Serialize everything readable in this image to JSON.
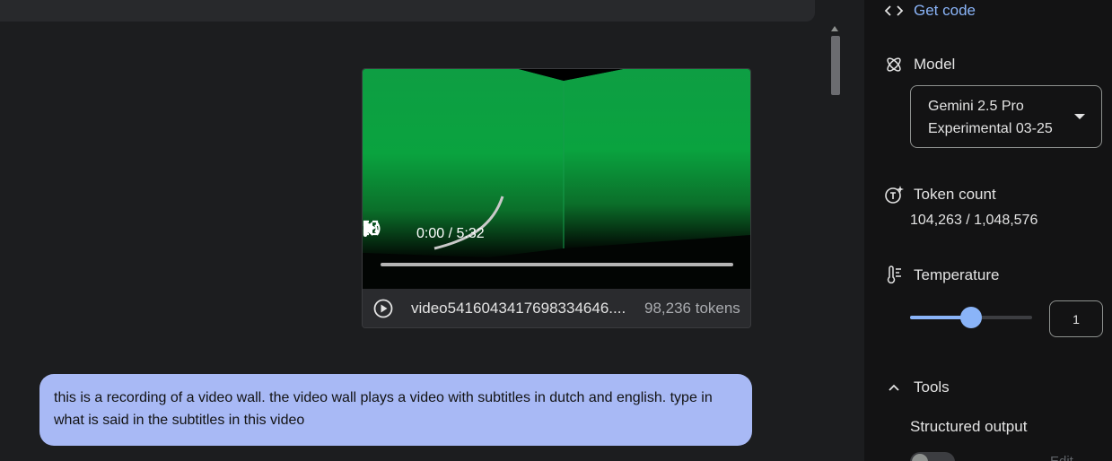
{
  "video": {
    "time": "0:00 / 5:32",
    "file_name": "video5416043417698334646....",
    "token_count": "98,236 tokens",
    "progress": 0
  },
  "message": {
    "text": "this is a recording of a video wall. the video wall plays a video with subtitles in dutch and english. type in what is said in the subtitles in this video"
  },
  "panel": {
    "get_code": "Get code",
    "model_label": "Model",
    "model_value": "Gemini 2.5 Pro Experimental 03-25",
    "token_label": "Token count",
    "token_value": "104,263 / 1,048,576",
    "temperature_label": "Temperature",
    "temperature_value": "1",
    "temperature_fraction": 0.5,
    "tools_label": "Tools",
    "structured_output_label": "Structured output",
    "edit_label": "Edit"
  },
  "colors": {
    "accent": "#8ab4f8",
    "bubble": "#a8b9f5",
    "panel_bg": "#131314",
    "chat_bg": "#1c1d1f"
  }
}
